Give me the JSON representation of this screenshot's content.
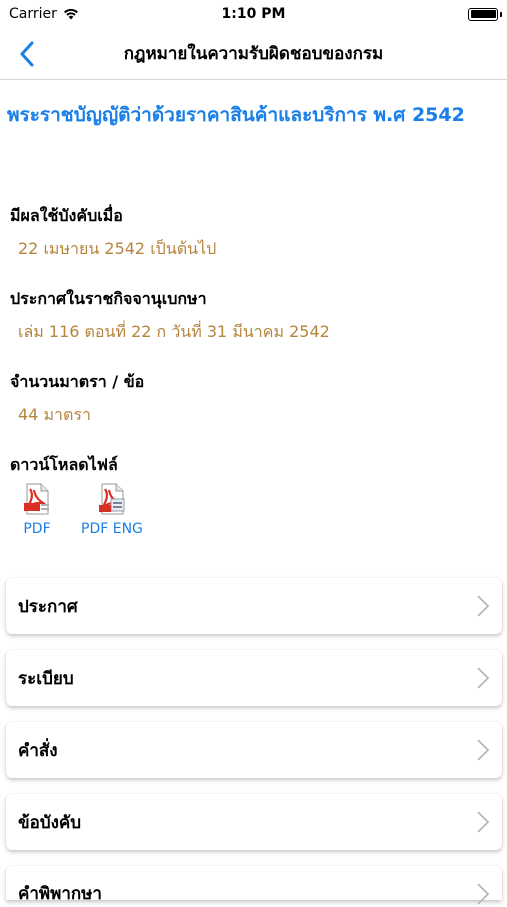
{
  "status_bar": {
    "carrier": "Carrier",
    "time": "1:10 PM"
  },
  "nav": {
    "title": "กฎหมายในความรับผิดชอบของกรม"
  },
  "law_title": "พระราชบัญญัติว่าด้วยราคาสินค้าและบริการ พ.ศ 2542",
  "fields": [
    {
      "label": "มีผลใช้บังคับเมื่อ",
      "value": "22 เมษายน 2542 เป็นต้นไป"
    },
    {
      "label": "ประกาศในราชกิจจานุเบกษา",
      "value": "เล่ม 116 ตอนที่ 22 ก วันที่ 31 มีนาคม 2542"
    },
    {
      "label": "จำนวนมาตรา / ข้อ",
      "value": "44 มาตรา"
    }
  ],
  "download": {
    "label": "ดาวน์โหลดไฟล์",
    "files": [
      {
        "caption": "PDF",
        "icon": "pdf-file-icon"
      },
      {
        "caption": "PDF ENG",
        "icon": "pdf-file-icon"
      }
    ]
  },
  "menu": [
    {
      "label": "ประกาศ"
    },
    {
      "label": "ระเบียบ"
    },
    {
      "label": "คำสั่ง"
    },
    {
      "label": "ข้อบังคับ"
    },
    {
      "label": "คำพิพากษา"
    }
  ],
  "colors": {
    "accent": "#1a7fe8",
    "value_text": "#b5853d",
    "pdf_red": "#d93025"
  }
}
